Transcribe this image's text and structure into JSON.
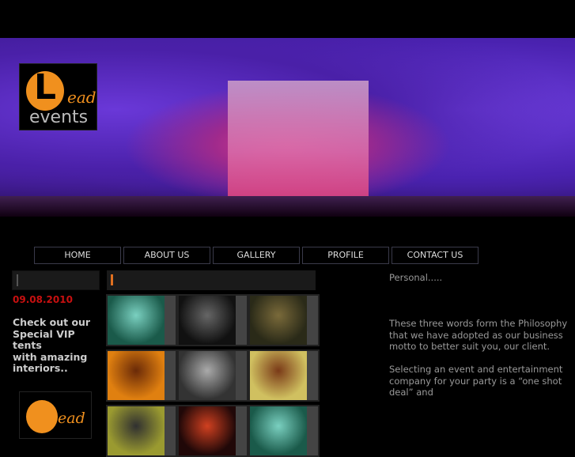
{
  "brand": {
    "logo_text": "Lead events"
  },
  "nav": [
    "HOME",
    "ABOUT US",
    "GALLERY",
    "PROFILE",
    "CONTACT US"
  ],
  "sidebar": {
    "date": "09.08.2010",
    "promo": "Check out our\nSpecial VIP\ntents\nwith amazing\ninteriors.."
  },
  "gallery": {
    "thumbnails": [
      {
        "name": "green-fairy",
        "colors": [
          "#1a5a4a",
          "#7ad0c0"
        ]
      },
      {
        "name": "twin-faces",
        "colors": [
          "#111",
          "#666"
        ]
      },
      {
        "name": "dark-room",
        "colors": [
          "#2a2a18",
          "#7a6a3a"
        ]
      },
      {
        "name": "orange-tree",
        "colors": [
          "#e08010",
          "#6a2a08"
        ]
      },
      {
        "name": "dark-angel",
        "colors": [
          "#333",
          "#aaa"
        ]
      },
      {
        "name": "forest-fantasy",
        "colors": [
          "#d0c060",
          "#7a3a18"
        ]
      },
      {
        "name": "yellow-abstract",
        "colors": [
          "#9a9a30",
          "#303030"
        ]
      },
      {
        "name": "red-burst",
        "colors": [
          "#200808",
          "#d04020"
        ]
      },
      {
        "name": "green-fairy-2",
        "colors": [
          "#1a5a4a",
          "#7ad0c0"
        ]
      }
    ]
  },
  "content": {
    "paragraphs": [
      "Personal.....",
      "",
      "These three words form the Philosophy that we have adopted as our business motto to better suit you, our client.",
      "Selecting an event and entertainment company for your party is a “one shot deal” and"
    ]
  },
  "colors": {
    "accent": "#f0901e",
    "date": "#c81010"
  }
}
